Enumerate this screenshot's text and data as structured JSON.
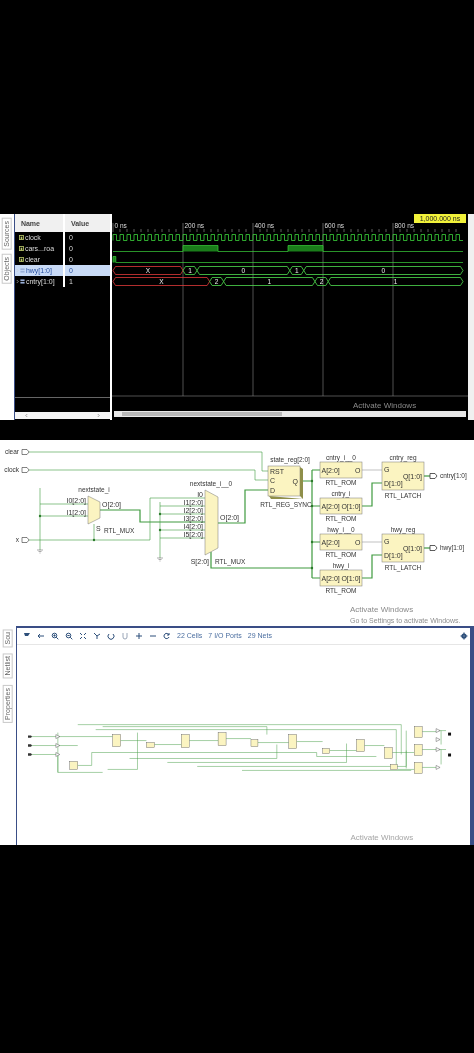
{
  "waveform_window": {
    "side_tabs": [
      "Sources",
      "Objects"
    ],
    "columns": [
      "Name",
      "Value"
    ],
    "signals": [
      {
        "name": "clock",
        "value": "0",
        "kind": "bit",
        "selected": false
      },
      {
        "name": "cars...roa",
        "value": "0",
        "kind": "bit",
        "selected": false
      },
      {
        "name": "clear",
        "value": "0",
        "kind": "bit",
        "selected": false
      },
      {
        "name": "hwy[1:0]",
        "value": "0",
        "kind": "bus",
        "selected": true,
        "segments": [
          {
            "value": "X",
            "kind": "unknown"
          },
          {
            "value": "1",
            "kind": "valid"
          },
          {
            "value": "0",
            "kind": "valid"
          },
          {
            "value": "1",
            "kind": "valid"
          },
          {
            "value": "0",
            "kind": "valid"
          }
        ]
      },
      {
        "name": "cntry[1:0]",
        "value": "1",
        "kind": "bus",
        "selected": false,
        "segments": [
          {
            "value": "X",
            "kind": "unknown"
          },
          {
            "value": "2",
            "kind": "valid"
          },
          {
            "value": "1",
            "kind": "valid"
          },
          {
            "value": "2",
            "kind": "valid"
          },
          {
            "value": "1",
            "kind": "valid"
          }
        ]
      }
    ],
    "time_ticks": [
      "0 ns",
      "200 ns",
      "400 ns",
      "600 ns",
      "800 ns"
    ],
    "cursor_time": "1,000.000 ns",
    "os_notice": "Activate Windows"
  },
  "rtl_schematic": {
    "inputs": [
      "clear",
      "clock",
      "x"
    ],
    "muxes": [
      {
        "name": "nextstate_i",
        "type": "RTL_MUX",
        "inputs": [
          "I0[2:0]",
          "I1[2:0]"
        ],
        "select": "S",
        "output": "O[2:0]"
      },
      {
        "name": "nextstate_i__0",
        "type": "RTL_MUX",
        "inputs": [
          "I0",
          "I1[2:0]",
          "I2[2:0]",
          "I3[2:0]",
          "I4[2:0]",
          "I5[2:0]"
        ],
        "select": "S[2:0]",
        "output": "O[2:0]"
      }
    ],
    "register": {
      "name": "state_reg[2:0]",
      "type": "RTL_REG_SYNC",
      "pins": [
        "RST",
        "C",
        "D",
        "Q"
      ]
    },
    "roms": [
      {
        "name": "cntry_i__0",
        "type": "RTL_ROM",
        "input": "A[2:0]",
        "output": "O"
      },
      {
        "name": "cntry_i",
        "type": "RTL_ROM",
        "input": "A[2:0]",
        "output": "O[1:0]"
      },
      {
        "name": "hwy_i__0",
        "type": "RTL_ROM",
        "input": "A[2:0]",
        "output": "O"
      },
      {
        "name": "hwy_i",
        "type": "RTL_ROM",
        "input": "A[2:0]",
        "output": "O[1:0]"
      }
    ],
    "latches": [
      {
        "name": "cntry_reg",
        "type": "RTL_LATCH",
        "pins": [
          "G",
          "D[1:0]",
          "Q[1:0]"
        ]
      },
      {
        "name": "hwy_reg",
        "type": "RTL_LATCH",
        "pins": [
          "G",
          "D[1:0]",
          "Q[1:0]"
        ]
      }
    ],
    "outputs": [
      "cntry[1:0]",
      "hwy[1:0]"
    ],
    "os_notice": "Activate Windows",
    "os_notice_hint": "Go to Settings to activate Windows."
  },
  "netlist_window": {
    "side_tabs": [
      "Sou",
      "Netlist",
      "Properties"
    ],
    "stats": [
      "22 Cells",
      "7 I/O Ports",
      "29 Nets"
    ],
    "os_notice": "Activate Windows"
  }
}
